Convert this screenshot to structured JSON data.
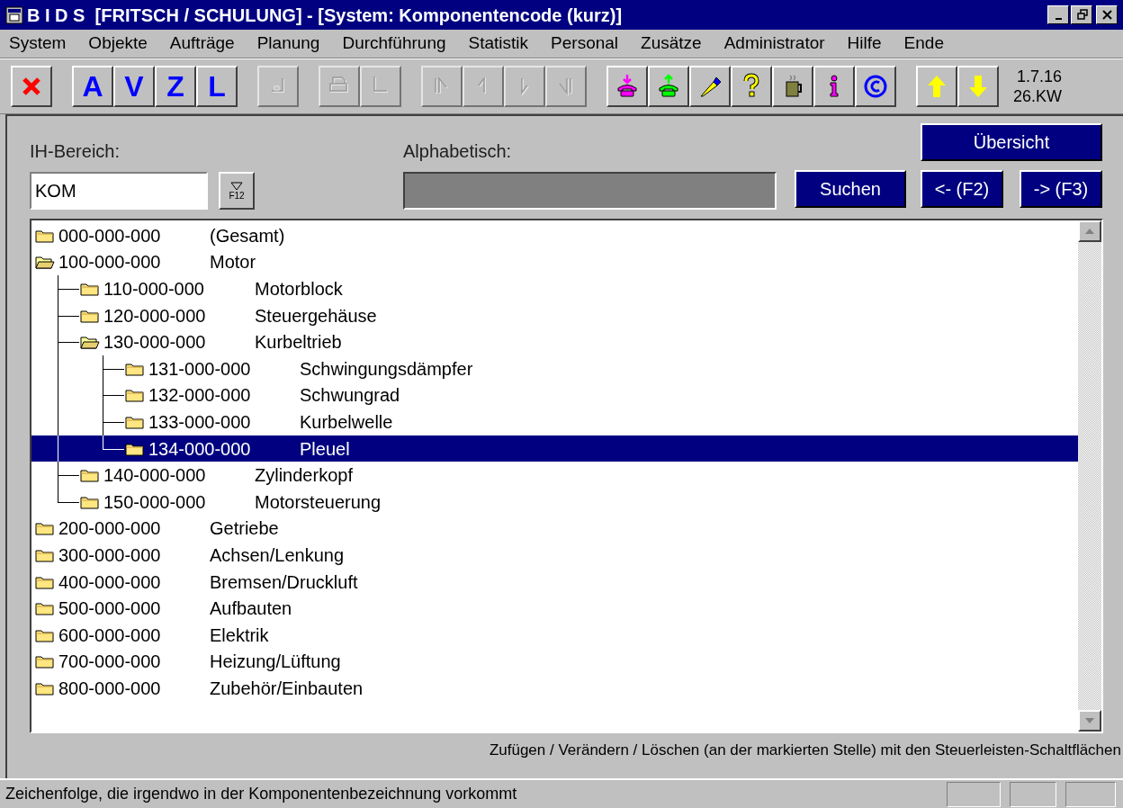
{
  "window": {
    "title": "B I D S  [FRITSCH / SCHULUNG] - [System: Komponentencode (kurz)]"
  },
  "menu": [
    "System",
    "Objekte",
    "Aufträge",
    "Planung",
    "Durchführung",
    "Statistik",
    "Personal",
    "Zusätze",
    "Administrator",
    "Hilfe",
    "Ende"
  ],
  "toolbar": [
    {
      "buttons": [
        {
          "kind": "close",
          "disabled": false
        }
      ]
    },
    {
      "buttons": [
        {
          "kind": "letter",
          "label": "A",
          "disabled": false
        },
        {
          "kind": "letter",
          "label": "V",
          "disabled": false
        },
        {
          "kind": "letter",
          "label": "Z",
          "disabled": false
        },
        {
          "kind": "letter",
          "label": "L",
          "disabled": false
        }
      ]
    },
    {
      "buttons": [
        {
          "kind": "corner",
          "disabled": true
        }
      ]
    },
    {
      "buttons": [
        {
          "kind": "printer",
          "disabled": true
        },
        {
          "kind": "bracket",
          "disabled": true
        }
      ]
    },
    {
      "buttons": [
        {
          "kind": "first",
          "disabled": true
        },
        {
          "kind": "prev",
          "disabled": true
        },
        {
          "kind": "next",
          "disabled": true
        },
        {
          "kind": "last",
          "disabled": true
        }
      ]
    },
    {
      "buttons": [
        {
          "kind": "phonein",
          "disabled": false
        },
        {
          "kind": "phoneout",
          "disabled": false
        },
        {
          "kind": "pen",
          "disabled": false
        },
        {
          "kind": "question",
          "disabled": false
        },
        {
          "kind": "mug",
          "disabled": false
        },
        {
          "kind": "info",
          "disabled": false
        },
        {
          "kind": "copyright",
          "disabled": false
        }
      ]
    },
    {
      "buttons": [
        {
          "kind": "up",
          "disabled": false
        },
        {
          "kind": "down",
          "disabled": false
        }
      ]
    }
  ],
  "date": "1.7.16",
  "week": "26.KW",
  "form": {
    "area_label": "IH-Bereich:",
    "area_value": "KOM",
    "filter_key": "F12",
    "alpha_label": "Alphabetisch:",
    "search_button": "Suchen",
    "overview_button": "Übersicht",
    "prev_button": "<- (F2)",
    "next_button": "-> (F3)"
  },
  "tree": [
    {
      "code": "000-000-000",
      "name": "(Gesamt)",
      "expanded": false,
      "selected": false
    },
    {
      "code": "100-000-000",
      "name": "Motor",
      "expanded": true,
      "selected": false,
      "children": [
        {
          "code": "110-000-000",
          "name": "Motorblock",
          "expanded": false,
          "selected": false
        },
        {
          "code": "120-000-000",
          "name": "Steuergehäuse",
          "expanded": false,
          "selected": false
        },
        {
          "code": "130-000-000",
          "name": "Kurbeltrieb",
          "expanded": true,
          "selected": false,
          "children": [
            {
              "code": "131-000-000",
              "name": "Schwingungsdämpfer",
              "expanded": false,
              "selected": false
            },
            {
              "code": "132-000-000",
              "name": "Schwungrad",
              "expanded": false,
              "selected": false
            },
            {
              "code": "133-000-000",
              "name": "Kurbelwelle",
              "expanded": false,
              "selected": false
            },
            {
              "code": "134-000-000",
              "name": "Pleuel",
              "expanded": false,
              "selected": true
            }
          ]
        },
        {
          "code": "140-000-000",
          "name": "Zylinderkopf",
          "expanded": false,
          "selected": false
        },
        {
          "code": "150-000-000",
          "name": "Motorsteuerung",
          "expanded": false,
          "selected": false
        }
      ]
    },
    {
      "code": "200-000-000",
      "name": "Getriebe",
      "expanded": false,
      "selected": false
    },
    {
      "code": "300-000-000",
      "name": "Achsen/Lenkung",
      "expanded": false,
      "selected": false
    },
    {
      "code": "400-000-000",
      "name": "Bremsen/Druckluft",
      "expanded": false,
      "selected": false
    },
    {
      "code": "500-000-000",
      "name": "Aufbauten",
      "expanded": false,
      "selected": false
    },
    {
      "code": "600-000-000",
      "name": "Elektrik",
      "expanded": false,
      "selected": false
    },
    {
      "code": "700-000-000",
      "name": "Heizung/Lüftung",
      "expanded": false,
      "selected": false
    },
    {
      "code": "800-000-000",
      "name": "Zubehör/Einbauten",
      "expanded": false,
      "selected": false
    }
  ],
  "hint": "Zufügen / Verändern / Löschen (an der markierten Stelle) mit den Steuerleisten-Schaltflächen",
  "status_bar": {
    "text": "Zeichenfolge, die irgendwo in der Komponentenbezeichnung vorkommt"
  }
}
